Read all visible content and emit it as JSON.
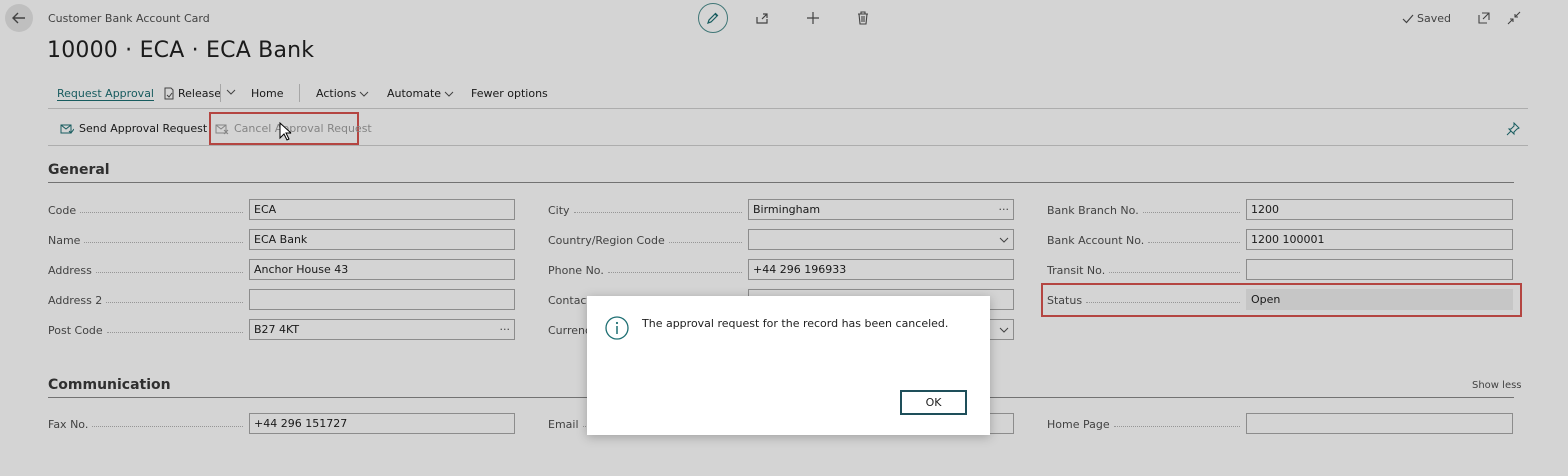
{
  "header": {
    "page_type": "Customer Bank Account Card",
    "title": "10000 · ECA · ECA Bank",
    "saved_label": "Saved"
  },
  "menu": {
    "request_approval": "Request Approval",
    "release": "Release",
    "home": "Home",
    "actions": "Actions",
    "automate": "Automate",
    "fewer_options": "Fewer options"
  },
  "actions": {
    "send_approval": "Send Approval Request",
    "cancel_approval": "Cancel Approval Request"
  },
  "general": {
    "heading": "General",
    "code": {
      "label": "Code",
      "value": "ECA"
    },
    "name": {
      "label": "Name",
      "value": "ECA Bank"
    },
    "address": {
      "label": "Address",
      "value": "Anchor House 43"
    },
    "address2": {
      "label": "Address 2",
      "value": ""
    },
    "post_code": {
      "label": "Post Code",
      "value": "B27 4KT"
    },
    "city": {
      "label": "City",
      "value": "Birmingham"
    },
    "country": {
      "label": "Country/Region Code",
      "value": ""
    },
    "phone": {
      "label": "Phone No.",
      "value": "+44 296 196933"
    },
    "contact": {
      "label": "Contact",
      "value": ""
    },
    "currency": {
      "label": "Currenc",
      "value": ""
    },
    "bank_branch": {
      "label": "Bank Branch No.",
      "value": "1200"
    },
    "bank_account": {
      "label": "Bank Account No.",
      "value": "1200 100001"
    },
    "transit": {
      "label": "Transit No.",
      "value": ""
    },
    "status": {
      "label": "Status",
      "value": "Open"
    }
  },
  "communication": {
    "heading": "Communication",
    "show_less": "Show less",
    "fax": {
      "label": "Fax No.",
      "value": "+44 296 151727"
    },
    "email": {
      "label": "Email",
      "value": ""
    },
    "home_page": {
      "label": "Home Page",
      "value": ""
    }
  },
  "dialog": {
    "message": "The approval request for the record has been canceled.",
    "ok_label": "OK"
  },
  "colors": {
    "accent": "#1e6f73",
    "highlight": "#d9534f"
  }
}
